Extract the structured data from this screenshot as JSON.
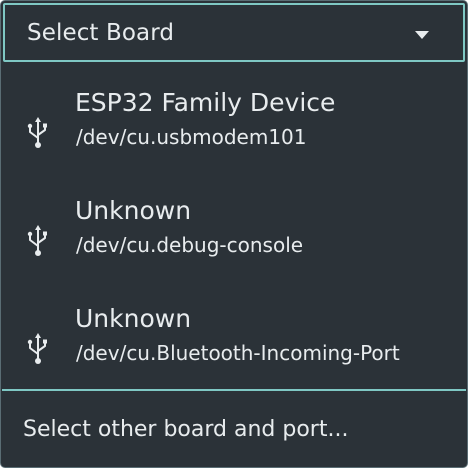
{
  "header": {
    "label": "Select Board",
    "caret_icon": "caret-down-icon"
  },
  "ports": [
    {
      "board": "ESP32 Family Device",
      "path": "/dev/cu.usbmodem101",
      "icon": "usb-icon"
    },
    {
      "board": "Unknown",
      "path": "/dev/cu.debug-console",
      "icon": "usb-icon"
    },
    {
      "board": "Unknown",
      "path": "/dev/cu.Bluetooth-Incoming-Port",
      "icon": "usb-icon"
    }
  ],
  "footer": {
    "label": "Select other board and port..."
  },
  "colors": {
    "background": "#2b3238",
    "text": "#e8ecee",
    "accent": "#7fc8c4"
  }
}
